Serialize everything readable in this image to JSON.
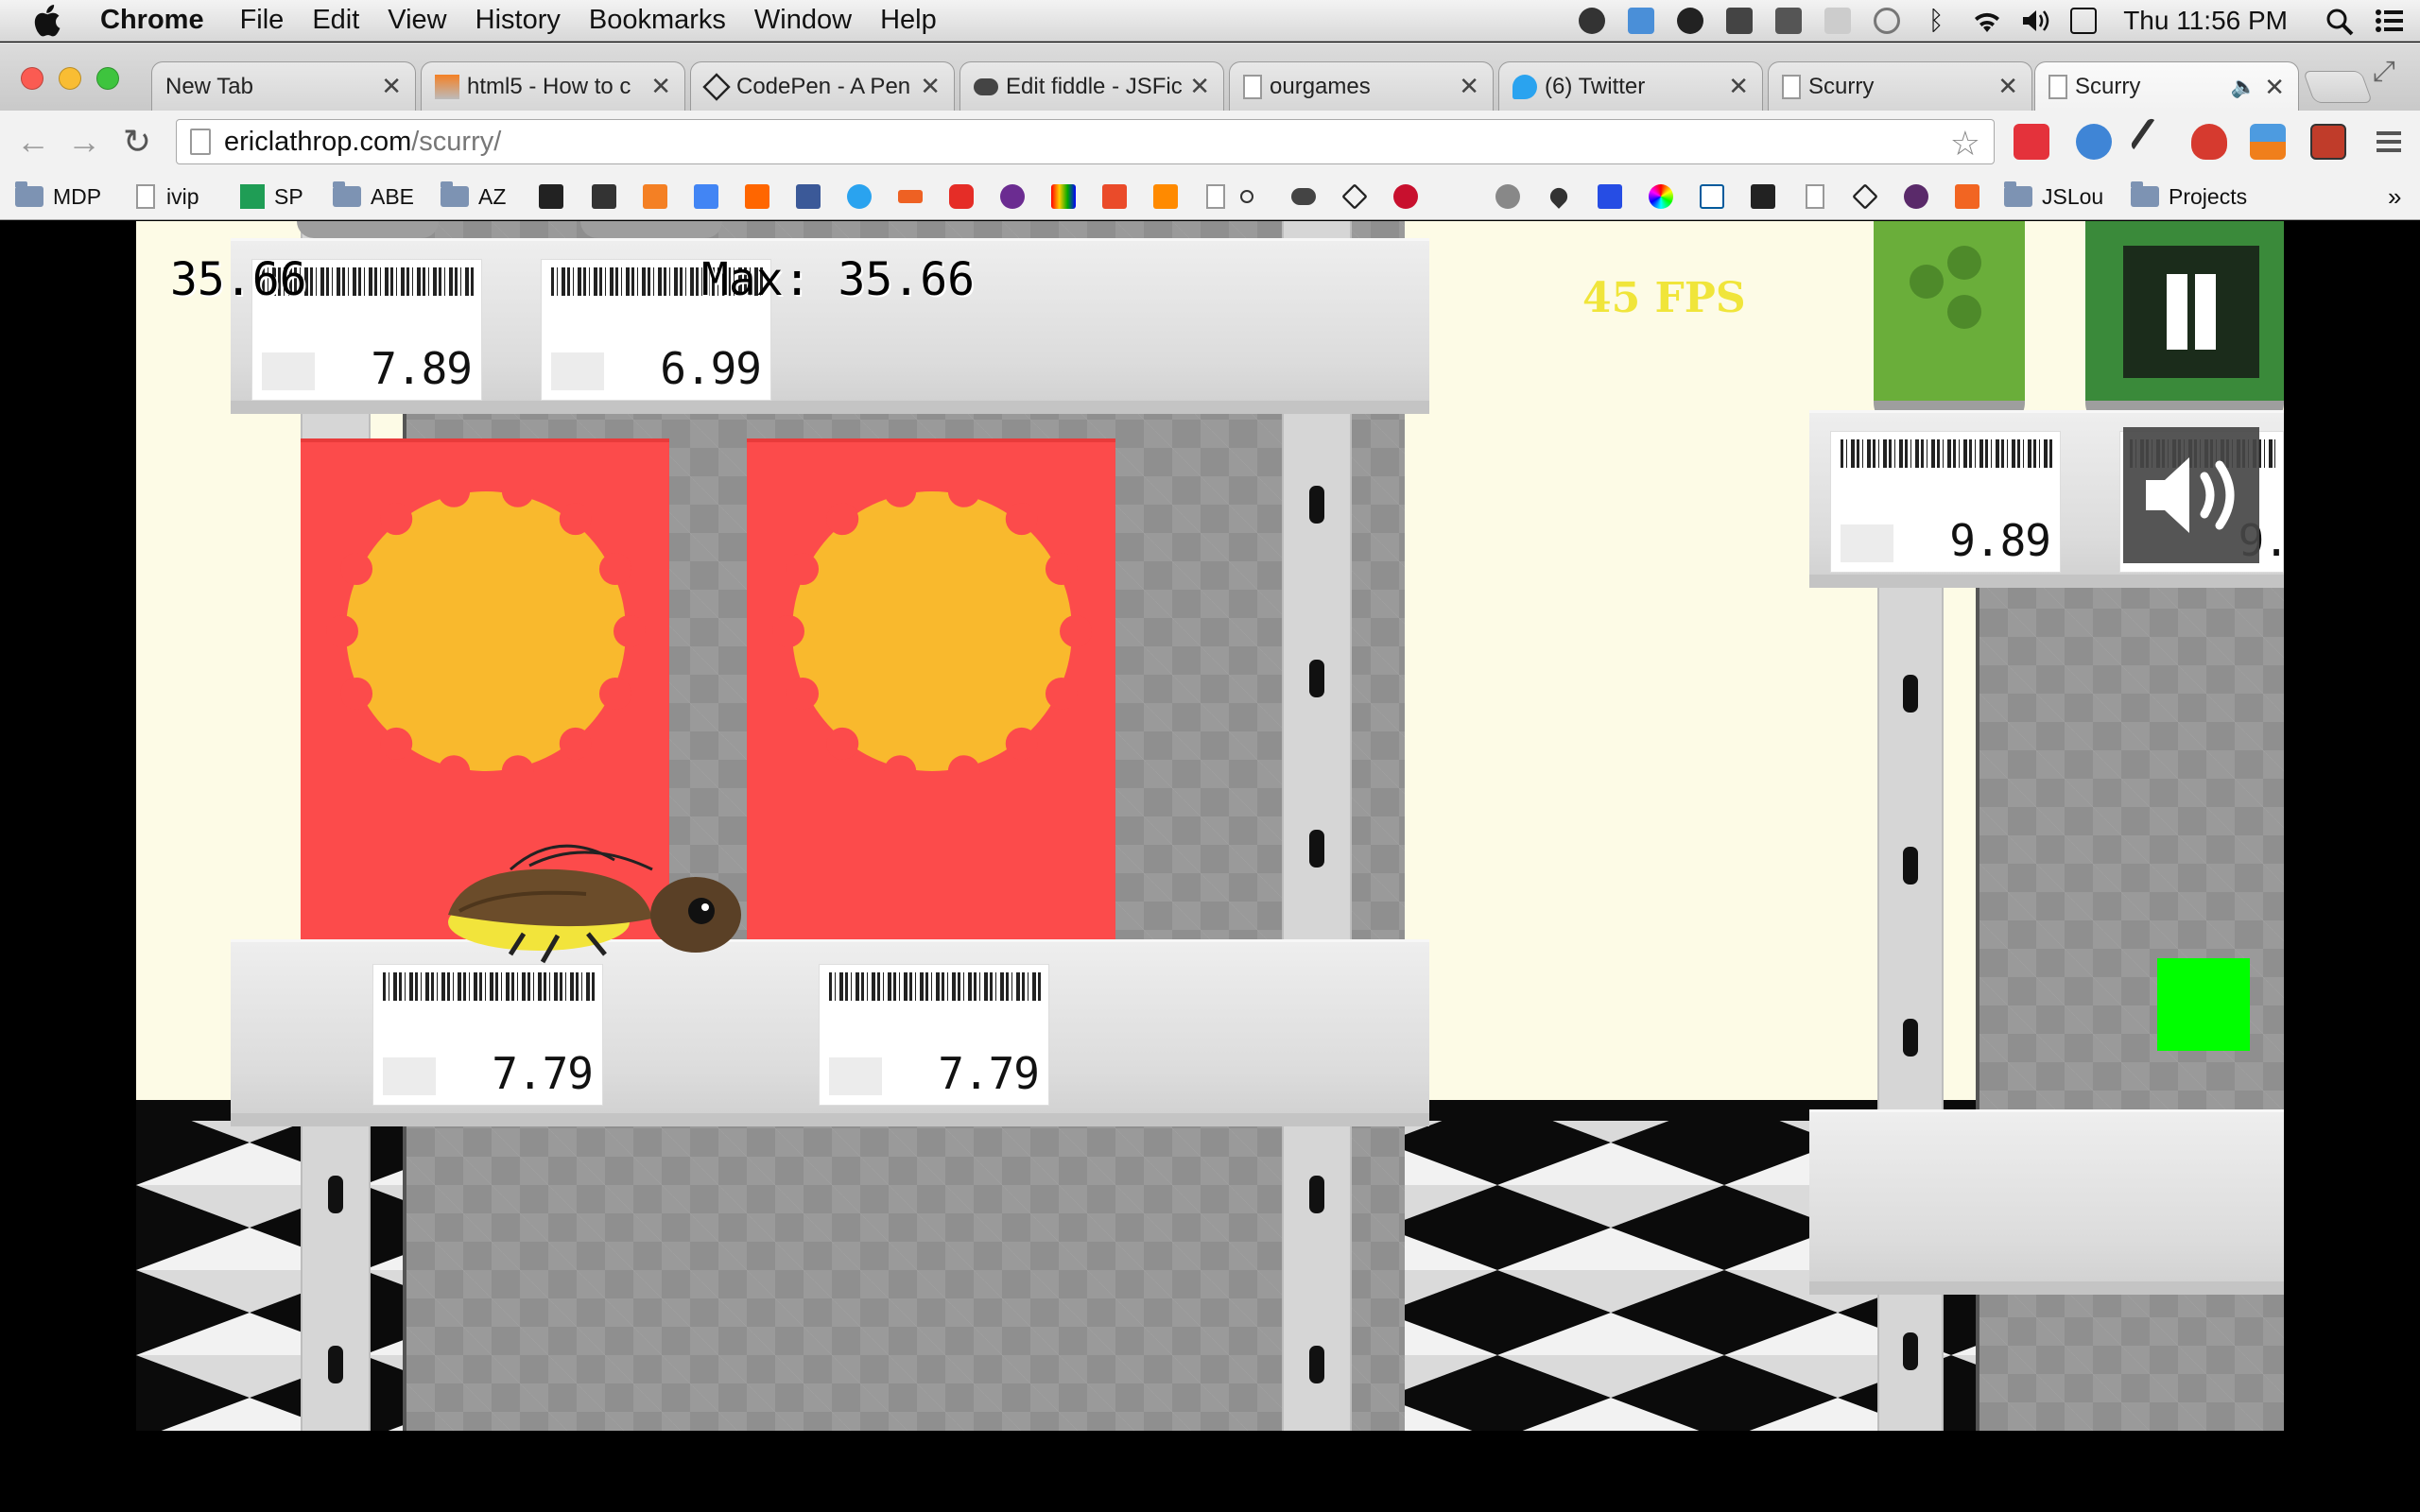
{
  "menubar": {
    "app_name": "Chrome",
    "menus": [
      "File",
      "Edit",
      "View",
      "History",
      "Bookmarks",
      "Window",
      "Help"
    ],
    "clock": "Thu 11:56 PM"
  },
  "tabs": [
    {
      "title": "New Tab"
    },
    {
      "title": "html5 - How to c"
    },
    {
      "title": "CodePen - A Pen"
    },
    {
      "title": "Edit fiddle - JSFic"
    },
    {
      "title": "ourgames"
    },
    {
      "title": "(6) Twitter"
    },
    {
      "title": "Scurry"
    },
    {
      "title": "Scurry"
    }
  ],
  "address": {
    "host": "ericlathrop.com",
    "path": "/scurry/"
  },
  "bookmarks": [
    {
      "label": "MDP"
    },
    {
      "label": "ivip"
    },
    {
      "label": "SP"
    },
    {
      "label": "ABE"
    },
    {
      "label": "AZ"
    },
    {
      "label": "JSLou"
    },
    {
      "label": "Projects"
    }
  ],
  "bookmarks_overflow": "»",
  "game": {
    "score": "35.66",
    "max_score": "Max: 35.66",
    "fps": "45 FPS",
    "price_tags": [
      "7.89",
      "6.99",
      "7.79",
      "7.79",
      "9.89",
      "9."
    ],
    "colors": {
      "box": "#fc4b4b",
      "sun": "#f9b92d",
      "background": "#fdfbe6",
      "fps_text": "#f0e53a",
      "goal": "#00ff00"
    }
  }
}
